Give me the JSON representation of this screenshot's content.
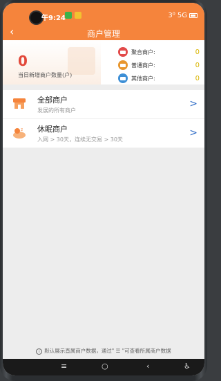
{
  "status_bar": {
    "time": "午9:24",
    "right_text": "3⁰ 5G"
  },
  "header": {
    "back_glyph": "‹",
    "title": "商户管理"
  },
  "stats": {
    "new_count": "0",
    "new_label": "当日新增商户数量(户)",
    "types": [
      {
        "label": "聚合商户:",
        "value": "0",
        "color": "#e24a4a"
      },
      {
        "label": "普通商户:",
        "value": "0",
        "color": "#e8962e"
      },
      {
        "label": "其他商户:",
        "value": "0",
        "color": "#3d8fd6"
      }
    ]
  },
  "list": [
    {
      "title": "全部商户",
      "sub": "发展的所有商户",
      "icon": "store-icon"
    },
    {
      "title": "休眠商户",
      "sub": "入网 > 30天，连续无交易 > 30天",
      "icon": "sleep-icon"
    }
  ],
  "footer": {
    "info_glyph": "i",
    "text": "默认展示直属商户数据，通过\" ☰ \"可查看所属商户数据"
  },
  "navbar": {
    "menu": "≡",
    "home": "○",
    "back": "‹",
    "accessibility": "♿"
  }
}
